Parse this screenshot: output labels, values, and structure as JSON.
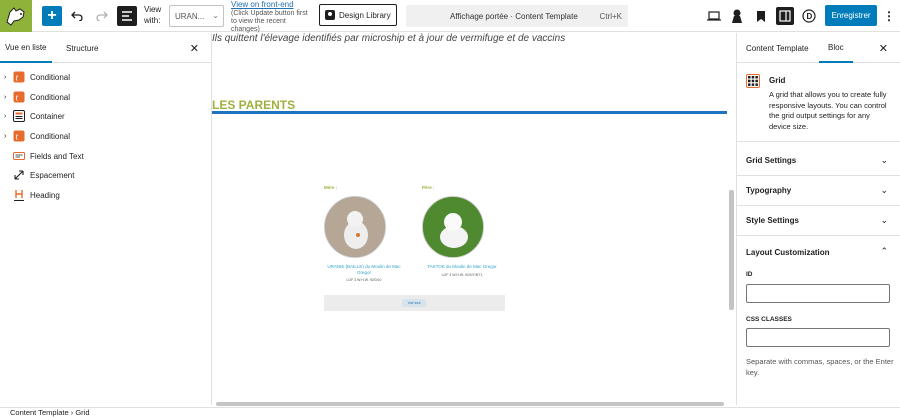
{
  "toolbar": {
    "view_with_label": "View with:",
    "view_select_value": "URAN...",
    "frontend_link": "View on front-end",
    "frontend_note": "(Click Update button first to view the recent changes)",
    "design_library_label": "Design Library",
    "command_title": "Affichage portée · Content Template",
    "command_shortcut": "Ctrl+K",
    "save_label": "Enregistrer"
  },
  "left_panel": {
    "tabs": [
      "Vue en liste",
      "Structure"
    ],
    "items": [
      {
        "label": "Conditional",
        "icon": "toolset-icon",
        "has_caret": true
      },
      {
        "label": "Conditional",
        "icon": "toolset-icon",
        "has_caret": true
      },
      {
        "label": "Container",
        "icon": "container-icon",
        "has_caret": true
      },
      {
        "label": "Conditional",
        "icon": "toolset-icon",
        "has_caret": true
      },
      {
        "label": "Fields and Text",
        "icon": "fields-icon",
        "has_caret": false
      },
      {
        "label": "Espacement",
        "icon": "spacer-icon",
        "has_caret": false
      },
      {
        "label": "Heading",
        "icon": "heading-icon",
        "has_caret": false
      }
    ]
  },
  "canvas": {
    "intro_text": "Ils quittent l'élevage identifiés par microship et à jour de vermifuge et de vaccins",
    "parents_heading": "LES PARENTS",
    "mother_label": "Mère :",
    "father_label": "Père :",
    "mother_name": "URANIE (BAILLE) du Moulin de Mac Gregor",
    "mother_lof": "LOF 3 W.H.W. 92/0/10",
    "father_name": "TAKTOK du Moulin de Mac Gregor",
    "father_lof": "LOF 3 W.H.W. 92/0/7/8/71",
    "footer_button": "Voir tout"
  },
  "right_panel": {
    "tabs": [
      "Content Template",
      "Bloc"
    ],
    "block_title": "Grid",
    "block_description": "A grid that allows you to create fully responsive layouts. You can control the grid output settings for any device size.",
    "sections": [
      "Grid Settings",
      "Typography",
      "Style Settings",
      "Layout Customization"
    ],
    "id_label": "ID",
    "css_label": "CSS CLASSES",
    "css_help": "Separate with commas, spaces, or the Enter key."
  },
  "breadcrumb": {
    "items": [
      "Content Template",
      "Grid"
    ]
  },
  "colors": {
    "accent": "#007cba",
    "brand_green": "#8fb33a",
    "heading_green": "#a0b040",
    "rule_blue": "#1e73be"
  }
}
